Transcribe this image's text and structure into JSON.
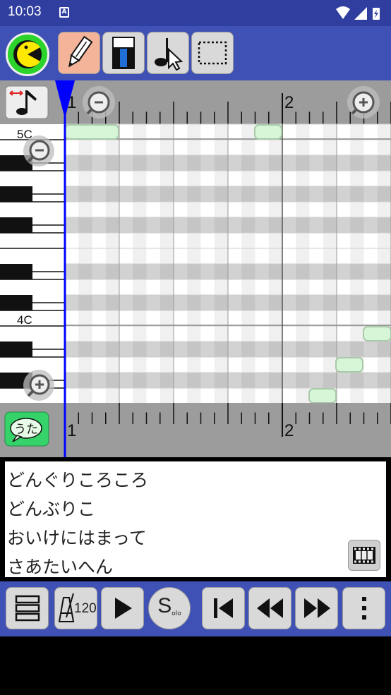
{
  "status": {
    "time": "10:03",
    "notification_letter": "A"
  },
  "toolbar": {
    "logo_icon": "pacman-icon",
    "tools": [
      {
        "name": "pencil",
        "active": true
      },
      {
        "name": "eraser",
        "active": false
      },
      {
        "name": "note-select",
        "active": false
      },
      {
        "name": "range-select",
        "active": false
      }
    ]
  },
  "editor": {
    "measure_top_1": "1",
    "measure_top_2": "2",
    "measure_bottom_1": "1",
    "measure_bottom_2": "2",
    "octave_high": "5C",
    "octave_low": "4C",
    "lyrics_button": "うた"
  },
  "lyrics": {
    "lines": [
      "どんぐりころころ",
      "どんぶりこ",
      "おいけにはまって",
      "さあたいへん"
    ]
  },
  "bottom": {
    "tempo": "120",
    "solo_big": "S",
    "solo_small": "olo"
  },
  "colors": {
    "status_bar": "#303f9f",
    "toolbar": "#3f51b5",
    "playhead": "#0000ff",
    "note_fill": "#d7f5d7"
  }
}
